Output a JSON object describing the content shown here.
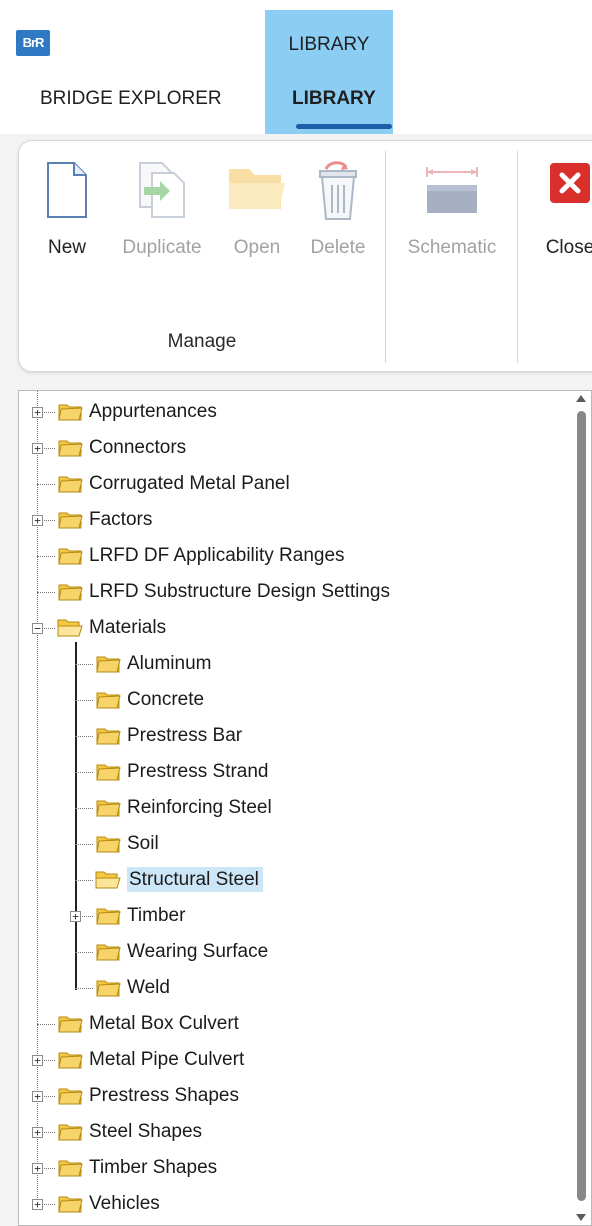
{
  "app": {
    "logo_text": "BrR"
  },
  "header": {
    "context_title": "LIBRARY",
    "tabs": [
      {
        "label": "BRIDGE EXPLORER",
        "active": false
      },
      {
        "label": "LIBRARY",
        "active": true
      }
    ]
  },
  "ribbon": {
    "buttons": [
      {
        "label": "New",
        "icon": "new-document-icon",
        "enabled": true
      },
      {
        "label": "Duplicate",
        "icon": "duplicate-icon",
        "enabled": false
      },
      {
        "label": "Open",
        "icon": "open-folder-icon",
        "enabled": false
      },
      {
        "label": "Delete",
        "icon": "delete-trash-icon",
        "enabled": false
      },
      {
        "label": "Schematic",
        "icon": "schematic-icon",
        "enabled": false
      },
      {
        "label": "Close",
        "icon": "close-icon",
        "enabled": true
      }
    ],
    "group_label": "Manage"
  },
  "tree": {
    "items": [
      {
        "label": "Appurtenances",
        "level": 0,
        "expandable": true,
        "expanded": false
      },
      {
        "label": "Connectors",
        "level": 0,
        "expandable": true,
        "expanded": false
      },
      {
        "label": "Corrugated Metal Panel",
        "level": 0,
        "expandable": false
      },
      {
        "label": "Factors",
        "level": 0,
        "expandable": true,
        "expanded": false
      },
      {
        "label": "LRFD DF Applicability Ranges",
        "level": 0,
        "expandable": false
      },
      {
        "label": "LRFD Substructure Design Settings",
        "level": 0,
        "expandable": false
      },
      {
        "label": "Materials",
        "level": 0,
        "expandable": true,
        "expanded": true
      },
      {
        "label": "Aluminum",
        "level": 1,
        "expandable": false
      },
      {
        "label": "Concrete",
        "level": 1,
        "expandable": false
      },
      {
        "label": "Prestress Bar",
        "level": 1,
        "expandable": false
      },
      {
        "label": "Prestress Strand",
        "level": 1,
        "expandable": false
      },
      {
        "label": "Reinforcing Steel",
        "level": 1,
        "expandable": false
      },
      {
        "label": "Soil",
        "level": 1,
        "expandable": false
      },
      {
        "label": "Structural Steel",
        "level": 1,
        "expandable": false,
        "selected": true
      },
      {
        "label": "Timber",
        "level": 1,
        "expandable": true,
        "expanded": false
      },
      {
        "label": "Wearing Surface",
        "level": 1,
        "expandable": false
      },
      {
        "label": "Weld",
        "level": 1,
        "expandable": false
      },
      {
        "label": "Metal Box Culvert",
        "level": 0,
        "expandable": false
      },
      {
        "label": "Metal Pipe Culvert",
        "level": 0,
        "expandable": true,
        "expanded": false
      },
      {
        "label": "Prestress Shapes",
        "level": 0,
        "expandable": true,
        "expanded": false
      },
      {
        "label": "Steel Shapes",
        "level": 0,
        "expandable": true,
        "expanded": false
      },
      {
        "label": "Timber Shapes",
        "level": 0,
        "expandable": true,
        "expanded": false
      },
      {
        "label": "Vehicles",
        "level": 0,
        "expandable": true,
        "expanded": false
      }
    ]
  },
  "colors": {
    "context_tab": "#8ccdf4",
    "tab_underline": "#1c5fa8",
    "selection": "#cde6f7",
    "folder": "#f5c842",
    "close_red": "#d9302c"
  }
}
